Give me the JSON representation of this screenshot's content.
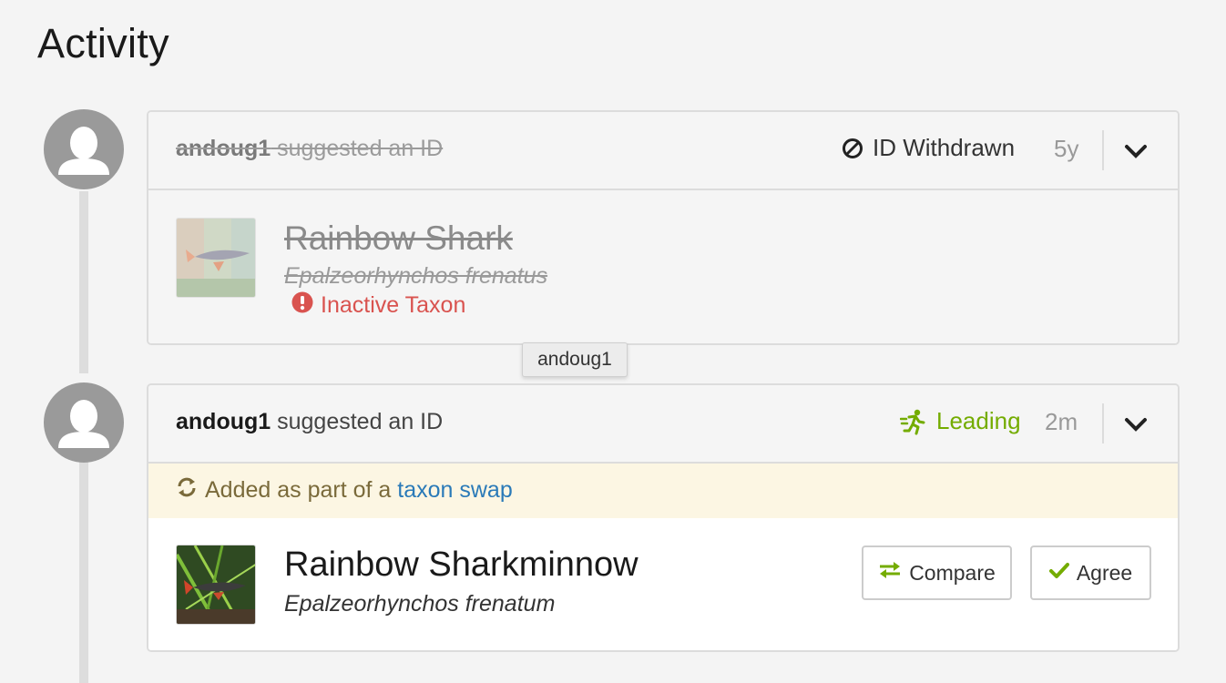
{
  "page": {
    "title": "Activity"
  },
  "tooltip": {
    "text": "andoug1"
  },
  "identifications": [
    {
      "user": "andoug1",
      "action": " suggested an ID",
      "status_label": "ID Withdrawn",
      "status_icon": "ban-icon",
      "time_ago": "5y",
      "common_name": "Rainbow Shark",
      "scientific_name": "Epalzeorhynchos frenatus",
      "warning": "Inactive Taxon"
    },
    {
      "user": "andoug1",
      "action": " suggested an ID",
      "status_label": "Leading",
      "status_icon": "running-person-icon",
      "status_color": "#74ac00",
      "time_ago": "2m",
      "banner_prefix": "Added as part of a ",
      "banner_link": "taxon swap",
      "common_name": "Rainbow Sharkminnow",
      "scientific_name": "Epalzeorhynchos frenatum",
      "compare_label": "Compare",
      "agree_label": "Agree"
    }
  ],
  "colors": {
    "accent_green": "#74ac00",
    "link_blue": "#2a7ab8",
    "error_red": "#d9534f"
  }
}
